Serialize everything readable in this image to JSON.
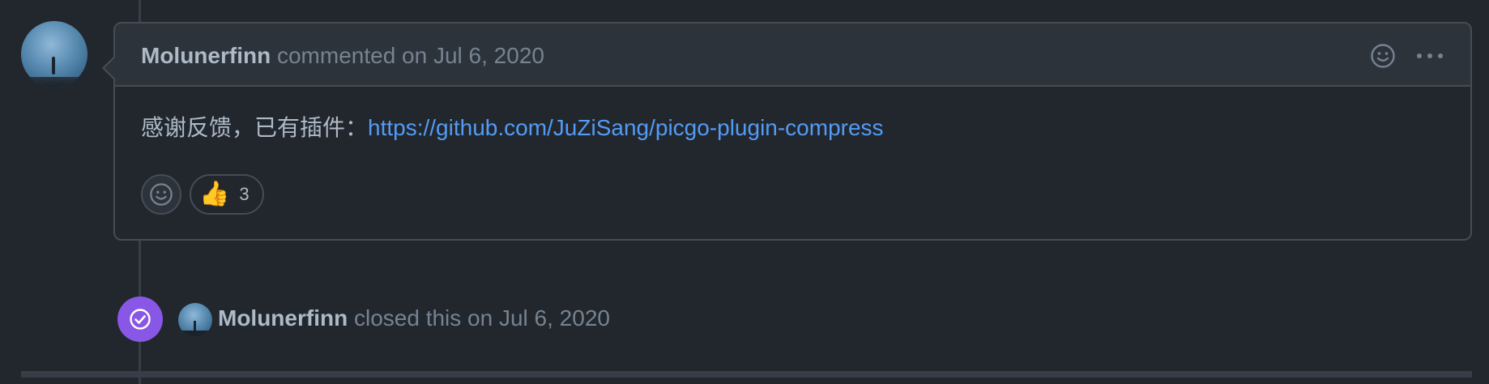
{
  "comment": {
    "author": "Molunerfinn",
    "meta": "commented on Jul 6, 2020",
    "body_text": "感谢反馈，已有插件：",
    "body_link": "https://github.com/JuZiSang/picgo-plugin-compress",
    "reactions": [
      {
        "emoji": "👍",
        "count": "3"
      }
    ]
  },
  "event": {
    "author": "Molunerfinn",
    "text": "closed this on Jul 6, 2020"
  },
  "colors": {
    "background": "#22272e",
    "header": "#2d333b",
    "border": "#444c56",
    "link": "#539bf5",
    "closed_badge": "#8957e5",
    "muted": "#768390"
  },
  "icons": [
    "smiley-icon",
    "kebab-horizontal-icon",
    "check-circle-icon"
  ]
}
